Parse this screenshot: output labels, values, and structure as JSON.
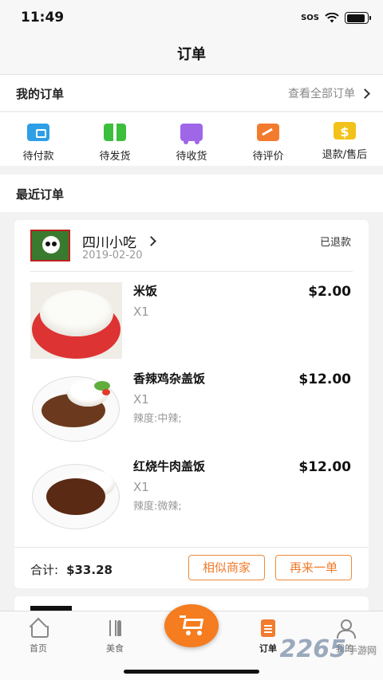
{
  "status_bar": {
    "time": "11:49",
    "sos": "SOS",
    "battery_level": 0.9
  },
  "header": {
    "title": "订单"
  },
  "my_orders": {
    "label": "我的订单",
    "view_all": "查看全部订单"
  },
  "order_status": [
    {
      "label": "待付款",
      "icon": "wallet-icon"
    },
    {
      "label": "待发货",
      "icon": "package-icon"
    },
    {
      "label": "待收货",
      "icon": "truck-icon"
    },
    {
      "label": "待评价",
      "icon": "review-icon"
    },
    {
      "label": "退款/售后",
      "icon": "refund-icon",
      "glyph": "$"
    }
  ],
  "recent": {
    "label": "最近订单"
  },
  "order": {
    "shop_name": "四川小吃",
    "date": "2019-02-20",
    "status": "已退款",
    "items": [
      {
        "name": "米饭",
        "qty": "X1",
        "option": "",
        "price": "$2.00"
      },
      {
        "name": "香辣鸡杂盖饭",
        "qty": "X1",
        "option": "辣度:中辣;",
        "price": "$12.00"
      },
      {
        "name": "红烧牛肉盖饭",
        "qty": "X1",
        "option": "辣度:微辣;",
        "price": "$12.00"
      }
    ],
    "total_label": "合计:",
    "total_value": "$33.28",
    "btn_similar": "相似商家",
    "btn_reorder": "再来一单"
  },
  "tabbar": {
    "items": [
      {
        "label": "首页",
        "icon": "home-icon"
      },
      {
        "label": "美食",
        "icon": "food-icon"
      },
      {
        "label": "",
        "icon": "cart-icon"
      },
      {
        "label": "订单",
        "icon": "order-icon"
      },
      {
        "label": "我的",
        "icon": "profile-icon"
      }
    ]
  },
  "watermark": {
    "text": "2265",
    "sub": "手游网"
  },
  "colors": {
    "accent": "#f57c1f",
    "pay": "#2e9fe6",
    "ship": "#3cbf3c",
    "receive": "#a066e8",
    "review": "#f27b2e",
    "refund": "#f3c21a"
  }
}
